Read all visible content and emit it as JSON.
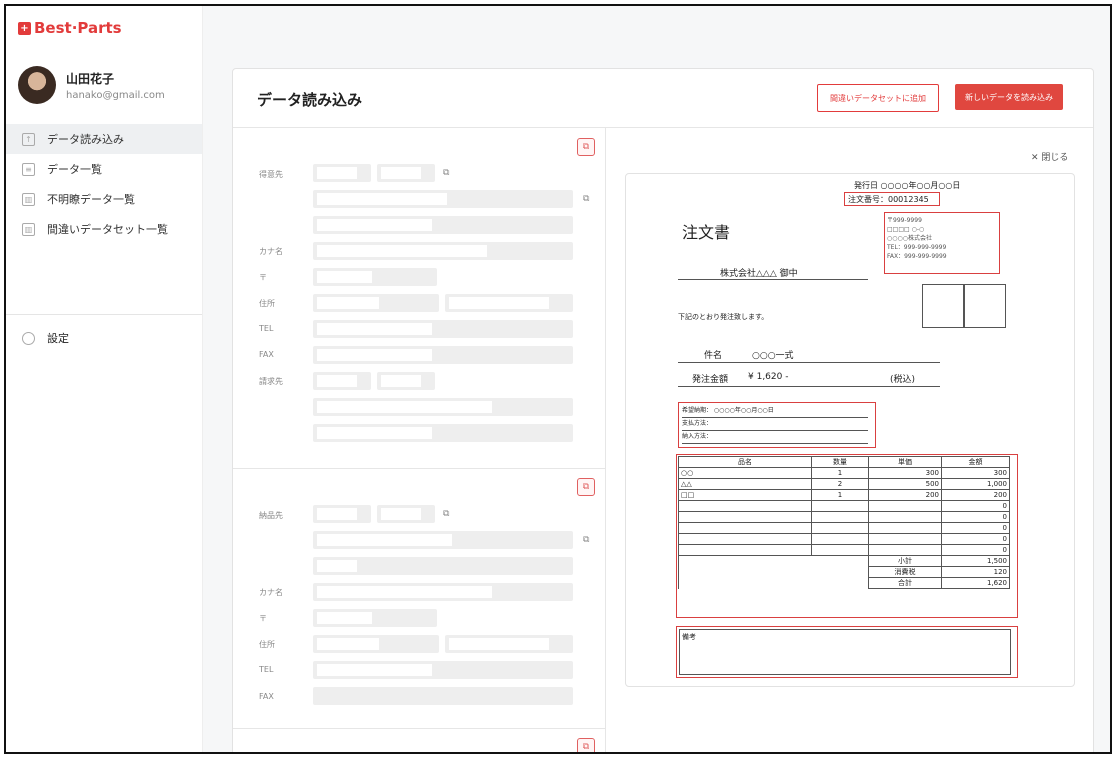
{
  "app": {
    "logo_mark": "+",
    "logo_text": "Best·Parts",
    "logo_dot": "."
  },
  "user": {
    "name": "山田花子",
    "email": "hanako@gmail.com"
  },
  "nav": [
    {
      "label": "データ読み込み",
      "icon": "file-upload-icon"
    },
    {
      "label": "データ一覧",
      "icon": "list-icon"
    },
    {
      "label": "不明瞭データ一覧",
      "icon": "table-icon"
    },
    {
      "label": "間違いデータセット一覧",
      "icon": "table-icon"
    }
  ],
  "settings_label": "設定",
  "page": {
    "title": "データ読み込み",
    "btn_add_wrong": "間違いデータセットに追加",
    "btn_load_new": "新しいデータを読み込み",
    "close_label": "閉じる"
  },
  "form": {
    "section1": {
      "customer": "得意先",
      "kana": "カナ名",
      "zip": "〒",
      "address": "住所",
      "tel": "TEL",
      "fax": "FAX",
      "billing": "請求先"
    },
    "section2": {
      "delivery": "納品先",
      "kana": "カナ名",
      "zip": "〒",
      "address": "住所",
      "tel": "TEL",
      "fax": "FAX"
    }
  },
  "doc": {
    "issue_date": "発行日  ○○○○年○○月○○日",
    "order_no": "注文番号：00012345",
    "title": "注文書",
    "to": "株式会社△△△  御中",
    "sender": [
      "〒999-9999",
      "□□□□  ○-○",
      "○○○○株式会社",
      "TEL：999-999-9999",
      "FAX：999-999-9999"
    ],
    "intro": "下記のとおり発注致します。",
    "subject_label": "件名",
    "subject": "○○○一式",
    "amount_label": "発注金額",
    "amount": "¥ 1,620 -",
    "tax": "(税込)",
    "terms": [
      "希望納期：  ○○○○年○○月○○日",
      "支払方法：",
      "納入方法："
    ],
    "table_headers": [
      "品名",
      "数量",
      "単価",
      "金額"
    ],
    "rows": [
      [
        "○○",
        "1",
        "300",
        "300"
      ],
      [
        "△△",
        "2",
        "500",
        "1,000"
      ],
      [
        "□□",
        "1",
        "200",
        "200"
      ],
      [
        "",
        "",
        "",
        "0"
      ],
      [
        "",
        "",
        "",
        "0"
      ],
      [
        "",
        "",
        "",
        "0"
      ],
      [
        "",
        "",
        "",
        "0"
      ],
      [
        "",
        "",
        "",
        "0"
      ]
    ],
    "totals": [
      {
        "label": "小計",
        "value": "1,500"
      },
      {
        "label": "消費税",
        "value": "120"
      },
      {
        "label": "合計",
        "value": "1,620"
      }
    ],
    "notes_label": "備考"
  },
  "colors": {
    "accent": "#e0473f",
    "highlight_box": "#d94040"
  }
}
